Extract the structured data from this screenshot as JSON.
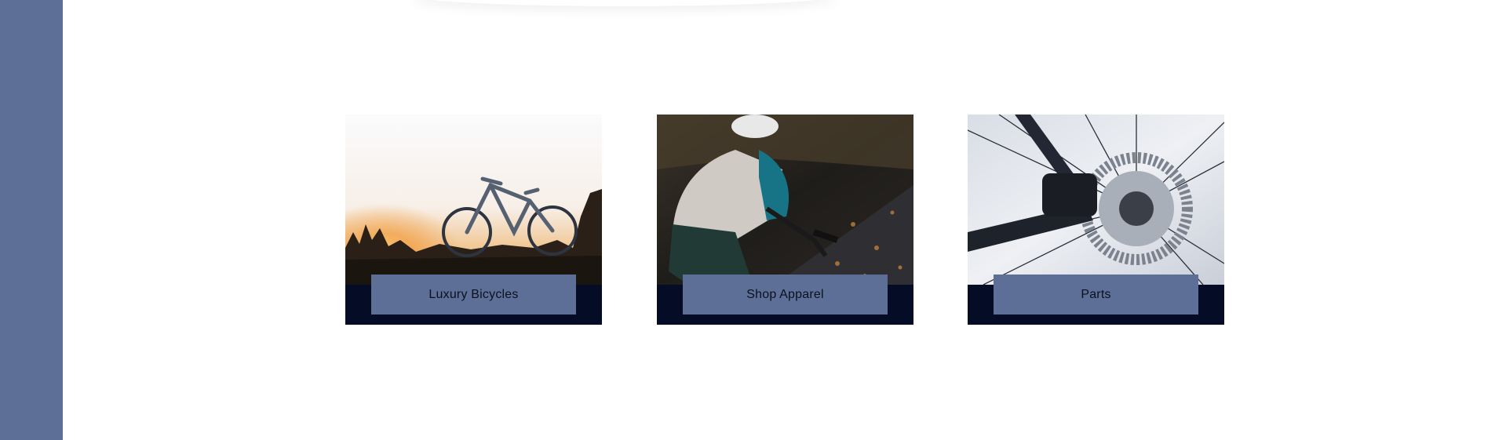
{
  "cards": [
    {
      "label": "Luxury Bicycles",
      "image": "bicycle-at-sunset"
    },
    {
      "label": "Shop Apparel",
      "image": "cyclist-riding-road"
    },
    {
      "label": "Parts",
      "image": "disc-brake-closeup"
    }
  ],
  "colors": {
    "sidebar": "#5d6f97",
    "label_background": "#5d6f97",
    "card_base": "#050d26",
    "label_text": "#0b1020"
  }
}
